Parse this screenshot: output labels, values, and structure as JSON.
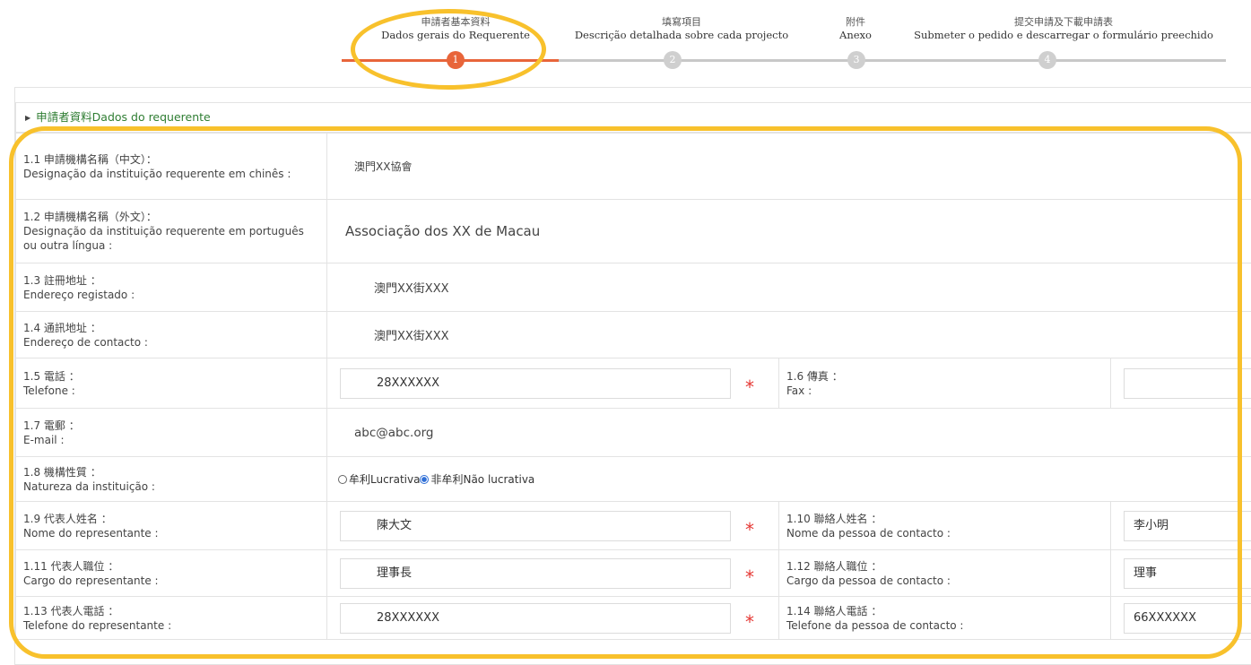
{
  "stepper": {
    "steps": [
      {
        "zh": "申請者基本資料",
        "pt": "Dados gerais do Requerente",
        "number": "1",
        "active": true
      },
      {
        "zh": "填寫項目",
        "pt": "Descrição detalhada sobre cada projecto",
        "number": "2",
        "active": false
      },
      {
        "zh": "附件",
        "pt": "Anexo",
        "number": "3",
        "active": false
      },
      {
        "zh": "提交申請及下載申請表",
        "pt": "Submeter o pedido e descarregar o formulário preechido",
        "number": "4",
        "active": false
      }
    ]
  },
  "section": {
    "title": "申請者資料Dados do requerente"
  },
  "form": {
    "f1_1": {
      "label_zh": "1.1 申請機構名稱（中文）：",
      "label_pt": "Designação da instituição requerente em chinês :",
      "value": "澳門XX協會"
    },
    "f1_2": {
      "label_zh": "1.2 申請機構名稱（外文）：",
      "label_pt": "Designação da instituição requerente em português ou outra língua :",
      "value": "Associação dos XX de Macau"
    },
    "f1_3": {
      "label_zh": "1.3 註冊地址 ：",
      "label_pt": "Endereço registado :",
      "value": "澳門XX街XXX"
    },
    "f1_4": {
      "label_zh": "1.4 通訊地址 ：",
      "label_pt": "Endereço de contacto :",
      "value": "澳門XX街XXX"
    },
    "f1_5": {
      "label_zh": "1.5 電話 ：",
      "label_pt": "Telefone :",
      "value": "28XXXXXX"
    },
    "f1_6": {
      "label_zh": "1.6 傳真 ：",
      "label_pt": "Fax :",
      "value": ""
    },
    "f1_7": {
      "label_zh": "1.7 電郵 ：",
      "label_pt": "E-mail :",
      "value": "abc@abc.org"
    },
    "f1_8": {
      "label_zh": "1.8 機構性質 ：",
      "label_pt": "Natureza da instituição :",
      "option1": "牟利Lucrativa",
      "option2": "非牟利Não lucrativa",
      "selected": "option2"
    },
    "f1_9": {
      "label_zh": "1.9 代表人姓名 ：",
      "label_pt": "Nome do representante :",
      "value": "陳大文"
    },
    "f1_10": {
      "label_zh": "1.10 聯絡人姓名 ：",
      "label_pt": "Nome da pessoa de contacto :",
      "value": "李小明"
    },
    "f1_11": {
      "label_zh": "1.11 代表人職位 ：",
      "label_pt": "Cargo do representante :",
      "value": "理事長"
    },
    "f1_12": {
      "label_zh": "1.12 聯絡人職位 ：",
      "label_pt": "Cargo da pessoa de contacto :",
      "value": "理事"
    },
    "f1_13": {
      "label_zh": "1.13 代表人電話 ：",
      "label_pt": "Telefone do representante :",
      "value": "28XXXXXX"
    },
    "f1_14": {
      "label_zh": "1.14 聯絡人電話 ：",
      "label_pt": "Telefone da pessoa de contacto :",
      "value": "66XXXXXX"
    },
    "required_mark": "*"
  },
  "colors": {
    "accent": "#e8653a",
    "section_text": "#2e7d32",
    "required": "#e53935",
    "annotation": "#f8c12c"
  }
}
